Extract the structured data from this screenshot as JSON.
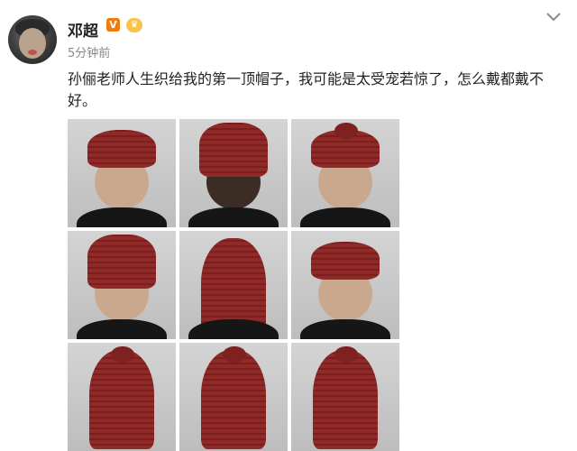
{
  "user": {
    "name": "邓超",
    "verified_badge": "V",
    "level_badge": "♛",
    "timestamp": "5分钟前"
  },
  "post": {
    "text": "孙俪老师人生织给我的第一顶帽子，我可能是太受宠若惊了，怎么戴都戴不好。"
  },
  "images": [
    {
      "label": "photo-1"
    },
    {
      "label": "photo-2"
    },
    {
      "label": "photo-3"
    },
    {
      "label": "photo-4"
    },
    {
      "label": "photo-5"
    },
    {
      "label": "photo-6"
    },
    {
      "label": "photo-7"
    },
    {
      "label": "photo-8"
    },
    {
      "label": "photo-9"
    }
  ],
  "colors": {
    "hat": "#8f2a28",
    "badge_orange": "#f07b0f",
    "badge_gold": "#f7c34a"
  },
  "icons": {
    "more": "chevron-down-icon"
  }
}
